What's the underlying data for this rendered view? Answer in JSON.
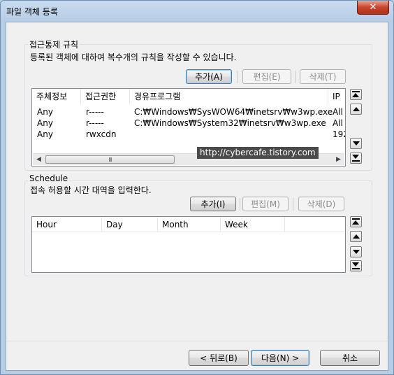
{
  "window": {
    "title": "파일 객체 등록",
    "close_glyph": "✕"
  },
  "acl": {
    "group_title": "접근통제 규칙",
    "description": "등록된 객체에 대하여 복수개의 규칙을 작성할 수 있습니다.",
    "add_label": "추가(A)",
    "edit_label": "편집(E)",
    "delete_label": "삭제(T)",
    "columns": [
      "주체정보",
      "접근권한",
      "경유프로그램",
      "IP"
    ],
    "rows": [
      [
        "Any",
        "r-----",
        "C:₩Windows₩SysWOW64₩inetsrv₩w3wp.exe",
        "All"
      ],
      [
        "Any",
        "r-----",
        "C:₩Windows₩System32₩inetsrv₩w3wp.exe",
        "All"
      ],
      [
        "Any",
        "rwxcdn",
        "",
        "192"
      ]
    ],
    "scroll_thumb_grip": "III"
  },
  "watermark": "http://cybercafe.tistory.com",
  "schedule": {
    "group_title": "Schedule",
    "description": "접속 허용할 시간 대역을 입력한다.",
    "add_label": "추가(I)",
    "edit_label": "편집(M)",
    "delete_label": "삭제(D)",
    "columns": [
      "Hour",
      "Day",
      "Month",
      "Week"
    ]
  },
  "footer": {
    "back_label": "< 뒤로(B)",
    "next_label": "다음(N) >",
    "cancel_label": "취소"
  },
  "icons": {
    "move_top": "move-top-icon",
    "move_up": "move-up-icon",
    "move_down": "move-down-icon",
    "move_bottom": "move-bottom-icon"
  }
}
